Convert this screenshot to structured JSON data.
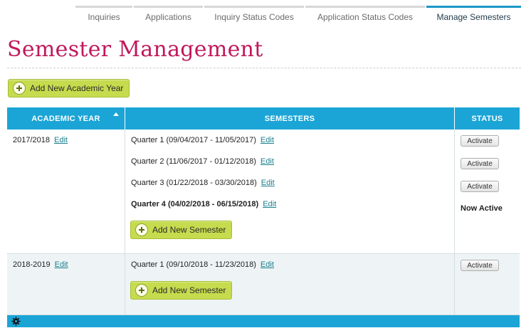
{
  "tabs": [
    {
      "label": "Inquiries"
    },
    {
      "label": "Applications"
    },
    {
      "label": "Inquiry Status Codes"
    },
    {
      "label": "Application Status Codes"
    },
    {
      "label": "Manage Semesters"
    }
  ],
  "page_title": "Semester Management",
  "add_year_label": "Add New Academic Year",
  "table": {
    "headers": {
      "academic_year": "ACADEMIC YEAR",
      "semesters": "SEMESTERS",
      "status": "STATUS"
    },
    "rows": [
      {
        "year": "2017/2018",
        "edit": "Edit",
        "semesters": [
          {
            "name": "Quarter 1 (09/04/2017 - 11/05/2017)",
            "edit": "Edit",
            "status": "Activate"
          },
          {
            "name": "Quarter 2 (11/06/2017 - 01/12/2018)",
            "edit": "Edit",
            "status": "Activate"
          },
          {
            "name": "Quarter 3 (01/22/2018 - 03/30/2018)",
            "edit": "Edit",
            "status": "Activate"
          },
          {
            "name": "Quarter 4 (04/02/2018 - 06/15/2018)",
            "edit": "Edit",
            "status": "Now Active"
          }
        ],
        "add_semester": "Add New Semester"
      },
      {
        "year": "2018-2019",
        "edit": "Edit",
        "semesters": [
          {
            "name": "Quarter 1 (09/10/2018 - 11/23/2018)",
            "edit": "Edit",
            "status": "Activate"
          }
        ],
        "add_semester": "Add New Semester"
      }
    ]
  },
  "colors": {
    "accent": "#1ba5d6",
    "title": "#c0185c",
    "button_green": "#c6dc4e"
  },
  "icons": [
    "plus-icon",
    "sort-asc-icon",
    "gear-icon"
  ]
}
